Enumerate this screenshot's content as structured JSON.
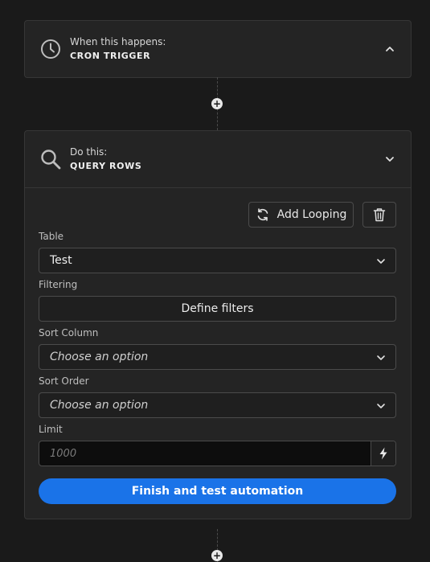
{
  "trigger": {
    "label": "When this happens:",
    "name": "CRON TRIGGER",
    "icon": "clock-icon",
    "expanded": true
  },
  "action": {
    "label": "Do this:",
    "name": "QUERY ROWS",
    "icon": "search-icon",
    "expanded": true,
    "add_looping_label": "Add Looping",
    "fields": {
      "table": {
        "label": "Table",
        "value": "Test"
      },
      "filtering": {
        "label": "Filtering",
        "button_label": "Define filters"
      },
      "sort_column": {
        "label": "Sort Column",
        "value": "Choose an option"
      },
      "sort_order": {
        "label": "Sort Order",
        "value": "Choose an option"
      },
      "limit": {
        "label": "Limit",
        "placeholder": "1000"
      }
    },
    "primary_button_label": "Finish and test automation"
  },
  "colors": {
    "background": "#1a1a1a",
    "card": "#242424",
    "accent": "#1a73e8"
  }
}
